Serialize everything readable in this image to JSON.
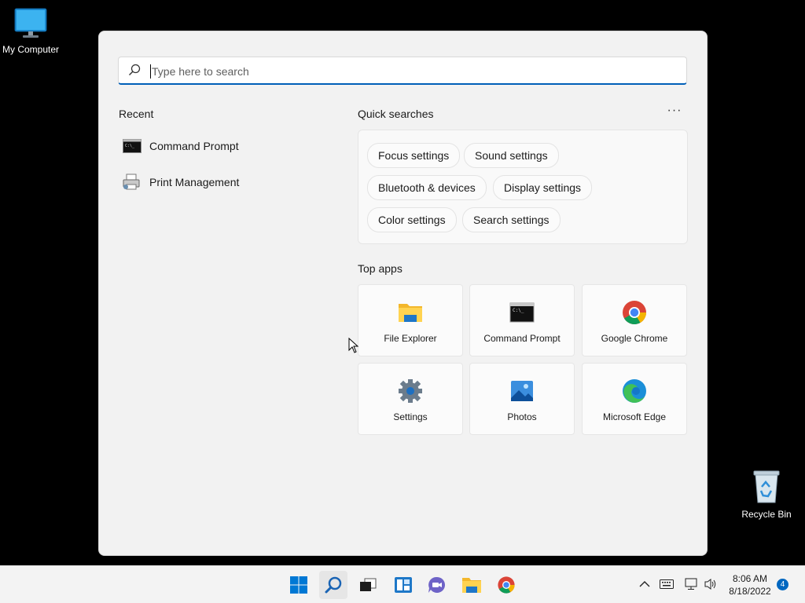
{
  "desktop": {
    "my_computer_label": "My Computer",
    "recycle_bin_label": "Recycle Bin"
  },
  "search": {
    "placeholder": "Type here to search",
    "accent": "#005fb8"
  },
  "recent": {
    "title": "Recent",
    "items": [
      {
        "label": "Command Prompt",
        "icon": "cmd-icon"
      },
      {
        "label": "Print Management",
        "icon": "printer-icon"
      }
    ]
  },
  "quick_searches": {
    "title": "Quick searches",
    "more_label": "···",
    "chips": [
      "Focus settings",
      "Sound settings",
      "Bluetooth & devices",
      "Display settings",
      "Color settings",
      "Search settings"
    ]
  },
  "top_apps": {
    "title": "Top apps",
    "apps": [
      {
        "label": "File Explorer",
        "icon": "folder-icon"
      },
      {
        "label": "Command Prompt",
        "icon": "cmd-icon"
      },
      {
        "label": "Google Chrome",
        "icon": "chrome-icon"
      },
      {
        "label": "Settings",
        "icon": "gear-icon"
      },
      {
        "label": "Photos",
        "icon": "photos-icon"
      },
      {
        "label": "Microsoft Edge",
        "icon": "edge-icon"
      }
    ]
  },
  "taskbar": {
    "items": [
      "start-icon",
      "search-icon",
      "task-view-icon",
      "widgets-icon",
      "chat-icon",
      "file-explorer-icon",
      "chrome-icon"
    ],
    "time": "8:06 AM",
    "date": "8/18/2022",
    "notification_count": "4"
  }
}
